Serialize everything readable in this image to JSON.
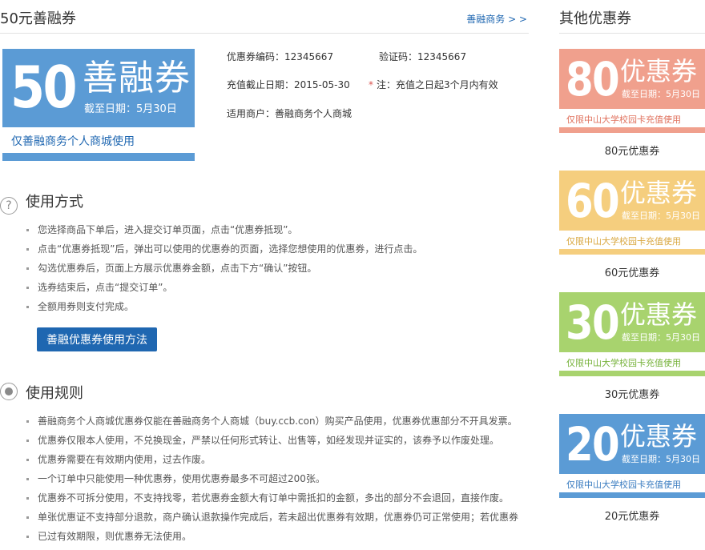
{
  "header": {
    "title": "50元善融券",
    "link": "善融商务 > >"
  },
  "coupon": {
    "amount": "50",
    "name": "善融券",
    "expiry": "截至日期：5月30日",
    "note": "仅善融商务个人商城使用",
    "color": "#5b9bd5",
    "bar_color": "#5b9bd5"
  },
  "info": {
    "code": "优惠券编码：12345667",
    "verify": "验证码：12345667",
    "deadline": "充值截止日期：2015-05-30",
    "remark": "注：充值之日起3个月内有效",
    "merchant": "适用商户：善融商务个人商城"
  },
  "usage": {
    "title": "使用方式",
    "icon": "question-icon",
    "items": [
      "您选择商品下单后，进入提交订单页面，点击“优惠券抵现”。",
      "点击“优惠券抵现”后，弹出可以使用的优惠券的页面，选择您想使用的优惠券，进行点击。",
      "勾选优惠券后，页面上方展示优惠券金额，点击下方“确认”按钮。",
      "选券结束后，点击“提交订单”。",
      "全额用券则支付完成。"
    ],
    "button": "善融优惠券使用方法"
  },
  "rules": {
    "title": "使用规则",
    "icon": "radio-dot-icon",
    "items": [
      "善融商务个人商城优惠券仅能在善融商务个人商城（buy.ccb.con）购买产品使用，优惠券优惠部分不开具发票。",
      "优惠券仅限本人使用，不兑换现金，严禁以任何形式转让、出售等，如经发现并证实的，该券予以作废处理。",
      "优惠券需要在有效期内使用，过去作废。",
      "一个订单中只能使用一种优惠券，使用优惠券最多不可超过200张。",
      "优惠券不可拆分使用，不支持找零，若优惠券金额大有订单中需抵扣的金额，多出的部分不会退回，直接作废。",
      "单张优惠证不支持部分退款，商户确认退款操作完成后，若未超出优惠券有效期，优惠券仍可正常使用；若优惠券",
      "已过有效期限，则优惠券无法使用。"
    ]
  },
  "sidebar": {
    "title": "其他优惠券",
    "coupons": [
      {
        "amount": "80",
        "name": "优惠券",
        "expiry": "截至日期：5月30日",
        "note": "仅限中山大学校园卡充值使用",
        "caption": "80元优惠券",
        "color": "#f0a08d",
        "note_color": "#e0735f"
      },
      {
        "amount": "60",
        "name": "优惠券",
        "expiry": "截至日期：5月30日",
        "note": "仅限中山大学校园卡充值使用",
        "caption": "60元优惠券",
        "color": "#f5ce7e",
        "note_color": "#d9a842"
      },
      {
        "amount": "30",
        "name": "优惠券",
        "expiry": "截至日期：5月30日",
        "note": "仅限中山大学校园卡充值使用",
        "caption": "30元优惠券",
        "color": "#a8d36e",
        "note_color": "#76b23a"
      },
      {
        "amount": "20",
        "name": "优惠券",
        "expiry": "截至日期：5月30日",
        "note": "仅限中山大学校园卡充值使用",
        "caption": "20元优惠券",
        "color": "#5b9bd5",
        "note_color": "#3a7cc0"
      }
    ]
  }
}
